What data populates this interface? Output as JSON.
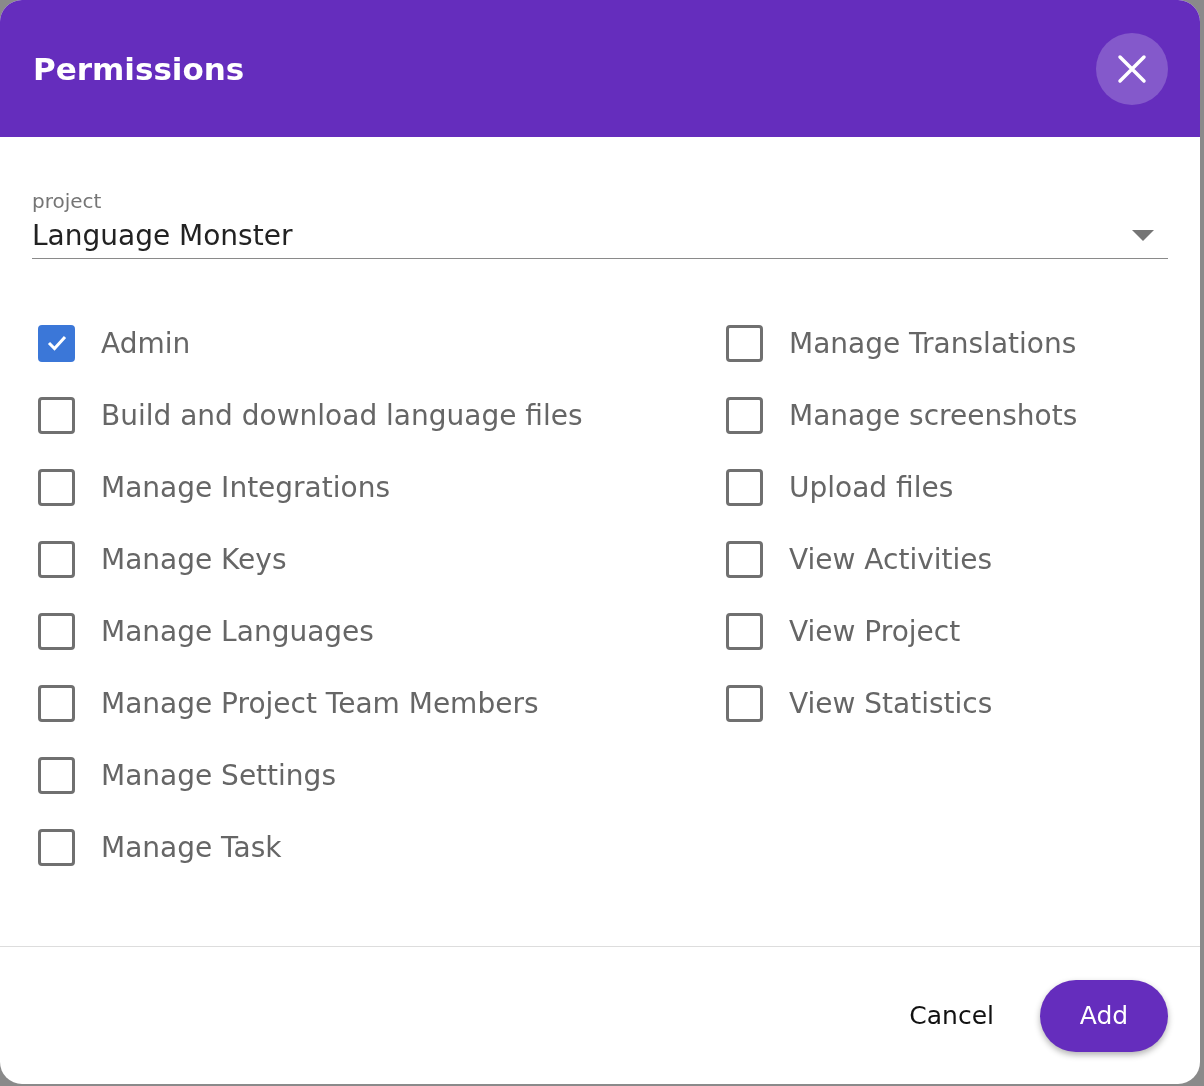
{
  "dialog": {
    "title": "Permissions"
  },
  "project_field": {
    "label": "project",
    "value": "Language Monster"
  },
  "permission_columns": [
    [
      {
        "label": "Admin",
        "checked": true
      },
      {
        "label": "Build and download language files",
        "checked": false
      },
      {
        "label": "Manage Integrations",
        "checked": false
      },
      {
        "label": "Manage Keys",
        "checked": false
      },
      {
        "label": "Manage Languages",
        "checked": false
      },
      {
        "label": "Manage Project Team Members",
        "checked": false
      },
      {
        "label": "Manage Settings",
        "checked": false
      },
      {
        "label": "Manage Task",
        "checked": false
      }
    ],
    [
      {
        "label": "Manage Translations",
        "checked": false
      },
      {
        "label": "Manage screenshots",
        "checked": false
      },
      {
        "label": "Upload files",
        "checked": false
      },
      {
        "label": "View Activities",
        "checked": false
      },
      {
        "label": "View Project",
        "checked": false
      },
      {
        "label": "View Statistics",
        "checked": false
      }
    ]
  ],
  "buttons": {
    "cancel": "Cancel",
    "add": "Add"
  }
}
